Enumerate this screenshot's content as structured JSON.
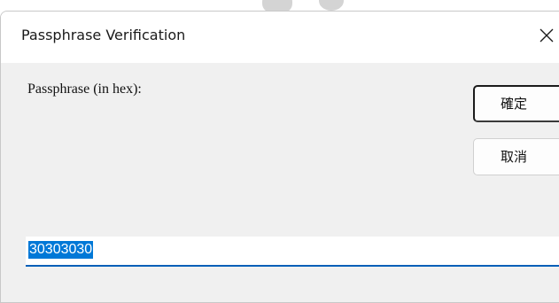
{
  "window": {
    "title": "Passphrase Verification",
    "close_icon": "close-icon"
  },
  "form": {
    "prompt_label": "Passphrase (in hex):",
    "hex_value": "30303030"
  },
  "buttons": {
    "ok_label": "確定",
    "cancel_label": "取消"
  },
  "colors": {
    "selection": "#0078d7",
    "focus_underline": "#005fb8",
    "dialog_bg": "#f0f0f0"
  }
}
